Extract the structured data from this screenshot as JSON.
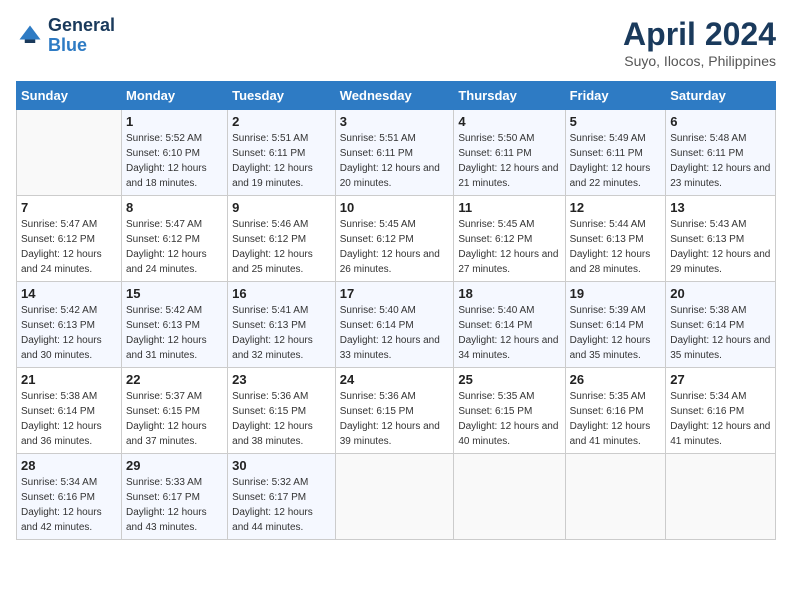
{
  "logo": {
    "line1": "General",
    "line2": "Blue"
  },
  "title": "April 2024",
  "subtitle": "Suyo, Ilocos, Philippines",
  "days_header": [
    "Sunday",
    "Monday",
    "Tuesday",
    "Wednesday",
    "Thursday",
    "Friday",
    "Saturday"
  ],
  "weeks": [
    [
      {
        "num": "",
        "sunrise": "",
        "sunset": "",
        "daylight": ""
      },
      {
        "num": "1",
        "sunrise": "Sunrise: 5:52 AM",
        "sunset": "Sunset: 6:10 PM",
        "daylight": "Daylight: 12 hours and 18 minutes."
      },
      {
        "num": "2",
        "sunrise": "Sunrise: 5:51 AM",
        "sunset": "Sunset: 6:11 PM",
        "daylight": "Daylight: 12 hours and 19 minutes."
      },
      {
        "num": "3",
        "sunrise": "Sunrise: 5:51 AM",
        "sunset": "Sunset: 6:11 PM",
        "daylight": "Daylight: 12 hours and 20 minutes."
      },
      {
        "num": "4",
        "sunrise": "Sunrise: 5:50 AM",
        "sunset": "Sunset: 6:11 PM",
        "daylight": "Daylight: 12 hours and 21 minutes."
      },
      {
        "num": "5",
        "sunrise": "Sunrise: 5:49 AM",
        "sunset": "Sunset: 6:11 PM",
        "daylight": "Daylight: 12 hours and 22 minutes."
      },
      {
        "num": "6",
        "sunrise": "Sunrise: 5:48 AM",
        "sunset": "Sunset: 6:11 PM",
        "daylight": "Daylight: 12 hours and 23 minutes."
      }
    ],
    [
      {
        "num": "7",
        "sunrise": "Sunrise: 5:47 AM",
        "sunset": "Sunset: 6:12 PM",
        "daylight": "Daylight: 12 hours and 24 minutes."
      },
      {
        "num": "8",
        "sunrise": "Sunrise: 5:47 AM",
        "sunset": "Sunset: 6:12 PM",
        "daylight": "Daylight: 12 hours and 24 minutes."
      },
      {
        "num": "9",
        "sunrise": "Sunrise: 5:46 AM",
        "sunset": "Sunset: 6:12 PM",
        "daylight": "Daylight: 12 hours and 25 minutes."
      },
      {
        "num": "10",
        "sunrise": "Sunrise: 5:45 AM",
        "sunset": "Sunset: 6:12 PM",
        "daylight": "Daylight: 12 hours and 26 minutes."
      },
      {
        "num": "11",
        "sunrise": "Sunrise: 5:45 AM",
        "sunset": "Sunset: 6:12 PM",
        "daylight": "Daylight: 12 hours and 27 minutes."
      },
      {
        "num": "12",
        "sunrise": "Sunrise: 5:44 AM",
        "sunset": "Sunset: 6:13 PM",
        "daylight": "Daylight: 12 hours and 28 minutes."
      },
      {
        "num": "13",
        "sunrise": "Sunrise: 5:43 AM",
        "sunset": "Sunset: 6:13 PM",
        "daylight": "Daylight: 12 hours and 29 minutes."
      }
    ],
    [
      {
        "num": "14",
        "sunrise": "Sunrise: 5:42 AM",
        "sunset": "Sunset: 6:13 PM",
        "daylight": "Daylight: 12 hours and 30 minutes."
      },
      {
        "num": "15",
        "sunrise": "Sunrise: 5:42 AM",
        "sunset": "Sunset: 6:13 PM",
        "daylight": "Daylight: 12 hours and 31 minutes."
      },
      {
        "num": "16",
        "sunrise": "Sunrise: 5:41 AM",
        "sunset": "Sunset: 6:13 PM",
        "daylight": "Daylight: 12 hours and 32 minutes."
      },
      {
        "num": "17",
        "sunrise": "Sunrise: 5:40 AM",
        "sunset": "Sunset: 6:14 PM",
        "daylight": "Daylight: 12 hours and 33 minutes."
      },
      {
        "num": "18",
        "sunrise": "Sunrise: 5:40 AM",
        "sunset": "Sunset: 6:14 PM",
        "daylight": "Daylight: 12 hours and 34 minutes."
      },
      {
        "num": "19",
        "sunrise": "Sunrise: 5:39 AM",
        "sunset": "Sunset: 6:14 PM",
        "daylight": "Daylight: 12 hours and 35 minutes."
      },
      {
        "num": "20",
        "sunrise": "Sunrise: 5:38 AM",
        "sunset": "Sunset: 6:14 PM",
        "daylight": "Daylight: 12 hours and 35 minutes."
      }
    ],
    [
      {
        "num": "21",
        "sunrise": "Sunrise: 5:38 AM",
        "sunset": "Sunset: 6:14 PM",
        "daylight": "Daylight: 12 hours and 36 minutes."
      },
      {
        "num": "22",
        "sunrise": "Sunrise: 5:37 AM",
        "sunset": "Sunset: 6:15 PM",
        "daylight": "Daylight: 12 hours and 37 minutes."
      },
      {
        "num": "23",
        "sunrise": "Sunrise: 5:36 AM",
        "sunset": "Sunset: 6:15 PM",
        "daylight": "Daylight: 12 hours and 38 minutes."
      },
      {
        "num": "24",
        "sunrise": "Sunrise: 5:36 AM",
        "sunset": "Sunset: 6:15 PM",
        "daylight": "Daylight: 12 hours and 39 minutes."
      },
      {
        "num": "25",
        "sunrise": "Sunrise: 5:35 AM",
        "sunset": "Sunset: 6:15 PM",
        "daylight": "Daylight: 12 hours and 40 minutes."
      },
      {
        "num": "26",
        "sunrise": "Sunrise: 5:35 AM",
        "sunset": "Sunset: 6:16 PM",
        "daylight": "Daylight: 12 hours and 41 minutes."
      },
      {
        "num": "27",
        "sunrise": "Sunrise: 5:34 AM",
        "sunset": "Sunset: 6:16 PM",
        "daylight": "Daylight: 12 hours and 41 minutes."
      }
    ],
    [
      {
        "num": "28",
        "sunrise": "Sunrise: 5:34 AM",
        "sunset": "Sunset: 6:16 PM",
        "daylight": "Daylight: 12 hours and 42 minutes."
      },
      {
        "num": "29",
        "sunrise": "Sunrise: 5:33 AM",
        "sunset": "Sunset: 6:17 PM",
        "daylight": "Daylight: 12 hours and 43 minutes."
      },
      {
        "num": "30",
        "sunrise": "Sunrise: 5:32 AM",
        "sunset": "Sunset: 6:17 PM",
        "daylight": "Daylight: 12 hours and 44 minutes."
      },
      {
        "num": "",
        "sunrise": "",
        "sunset": "",
        "daylight": ""
      },
      {
        "num": "",
        "sunrise": "",
        "sunset": "",
        "daylight": ""
      },
      {
        "num": "",
        "sunrise": "",
        "sunset": "",
        "daylight": ""
      },
      {
        "num": "",
        "sunrise": "",
        "sunset": "",
        "daylight": ""
      }
    ]
  ]
}
